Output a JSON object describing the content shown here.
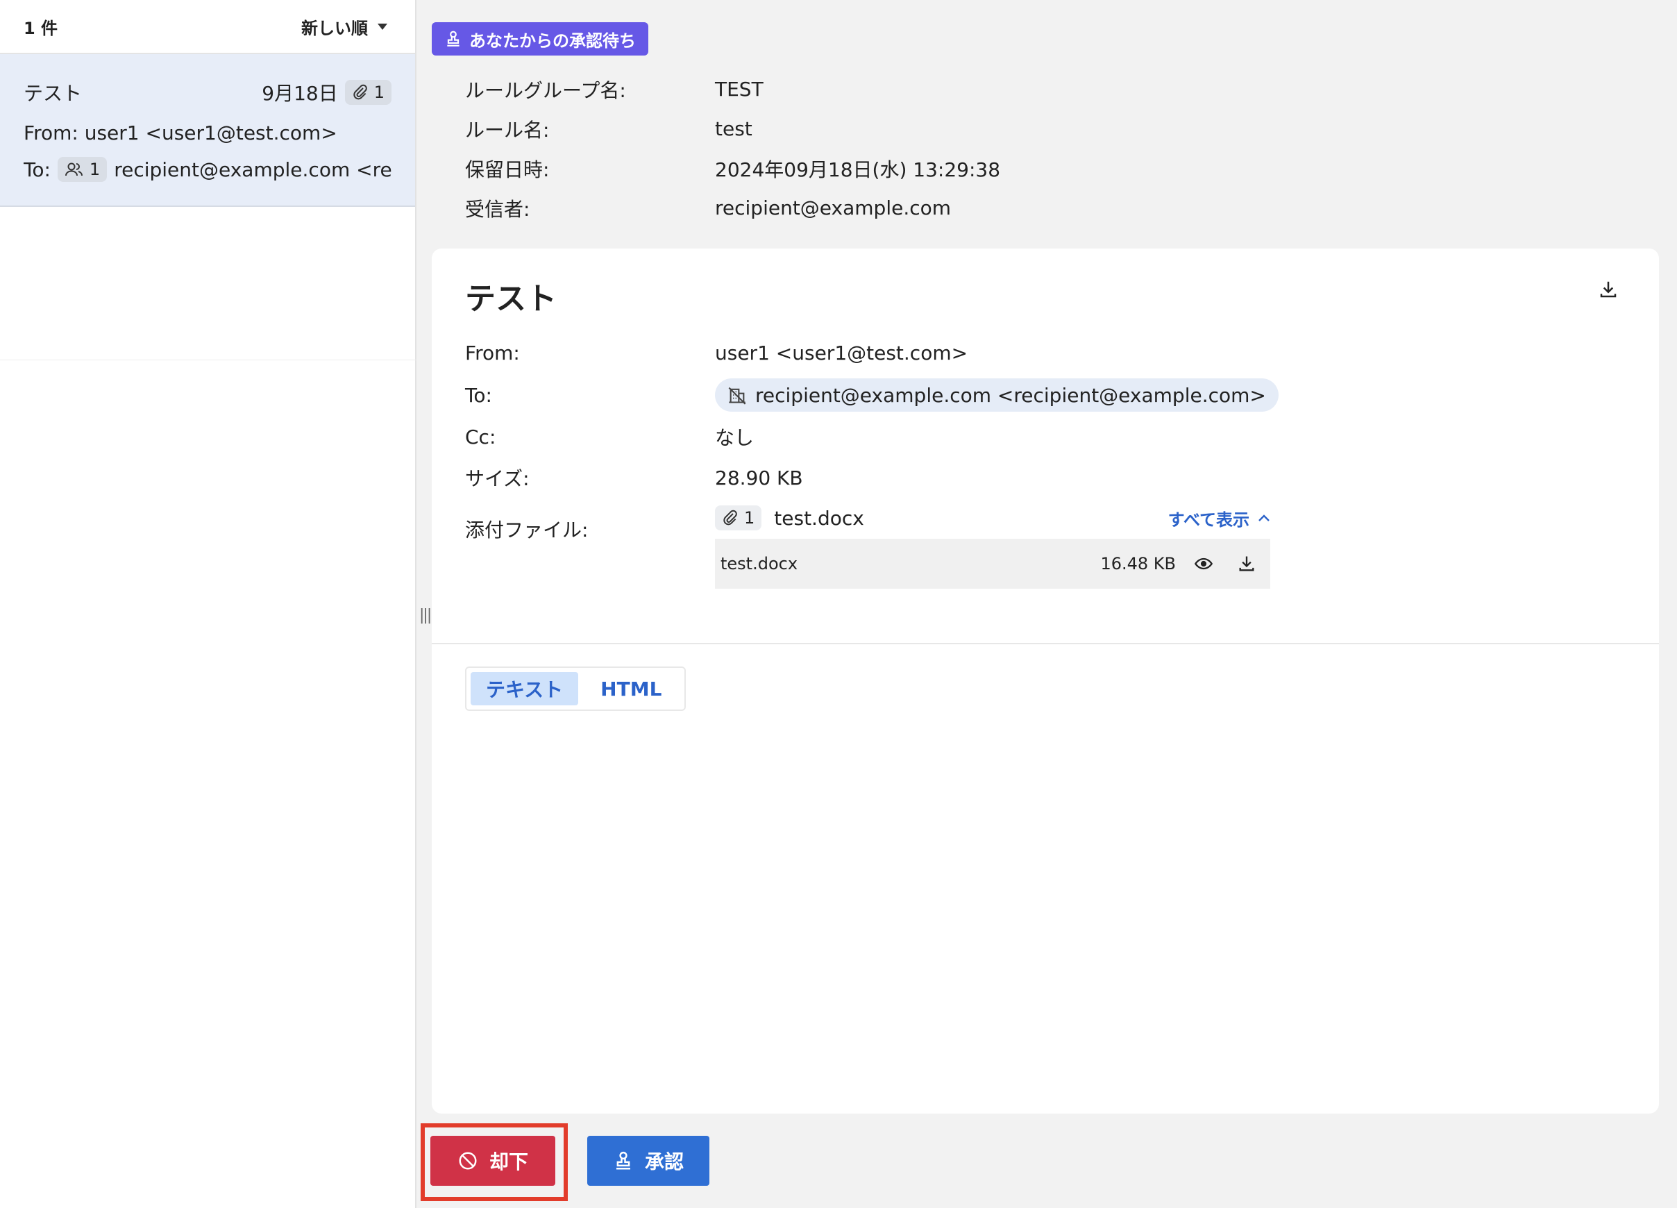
{
  "list": {
    "count_label": "1 件",
    "sort_label": "新しい順",
    "items": [
      {
        "subject": "テスト",
        "date": "9月18日",
        "attachment_count": "1",
        "from": "From: user1 <user1@test.com>",
        "to_label": "To:",
        "recipient_count": "1",
        "to": "recipient@example.com <rec..."
      }
    ]
  },
  "status_badge": "あなたからの承認待ち",
  "meta": {
    "rows": [
      {
        "label": "ルールグループ名:",
        "value": "TEST"
      },
      {
        "label": "ルール名:",
        "value": "test"
      },
      {
        "label": "保留日時:",
        "value": "2024年09月18日(水) 13:29:38"
      },
      {
        "label": "受信者:",
        "value": "recipient@example.com"
      }
    ]
  },
  "message": {
    "subject": "テスト",
    "from_label": "From:",
    "from": "user1 <user1@test.com>",
    "to_label": "To:",
    "to": "recipient@example.com <recipient@example.com>",
    "cc_label": "Cc:",
    "cc": "なし",
    "size_label": "サイズ:",
    "size": "28.90 KB",
    "attachments_label": "添付ファイル:",
    "attachment_count": "1",
    "attachment_summary": "test.docx",
    "show_all": "すべて表示",
    "files": [
      {
        "name": "test.docx",
        "size": "16.48 KB"
      }
    ]
  },
  "tabs": [
    {
      "label": "テキスト",
      "active": true
    },
    {
      "label": "HTML",
      "active": false
    }
  ],
  "actions": {
    "reject": "却下",
    "approve": "承認"
  },
  "colors": {
    "badge": "#6658e6",
    "reject": "#d03247",
    "approve": "#2f6fd4",
    "link": "#2b62c9",
    "highlight_outline": "#e23c2b"
  }
}
